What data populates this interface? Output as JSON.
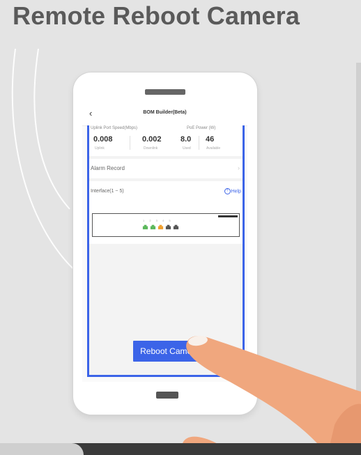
{
  "heading": "Remote Reboot Camera",
  "app": {
    "back_icon": "chevron-left-icon",
    "title": "BOM Builder(Beta)"
  },
  "stats": {
    "uplink_header": "Uplink Port Speed(Mbps)",
    "poe_header": "PoE Power (W)",
    "items": [
      {
        "value": "0.008",
        "label": "Uplink"
      },
      {
        "value": "0.002",
        "label": "Downlink"
      },
      {
        "value": "8.0",
        "label": "Used"
      },
      {
        "value": "46",
        "label": "Available"
      }
    ]
  },
  "alarm": {
    "label": "Alarm Record",
    "chevron_icon": "chevron-right-icon"
  },
  "interface": {
    "label": "Interface(1 ~ 5)",
    "help_label": "Help",
    "help_icon": "question-circle-icon",
    "port_numbers": "1 2 3 4 5",
    "ports": [
      {
        "status": "active",
        "color": "#5cb85c"
      },
      {
        "status": "active",
        "color": "#5cb85c"
      },
      {
        "status": "poe",
        "color": "#f0a030"
      },
      {
        "status": "inactive",
        "color": "#555555"
      },
      {
        "status": "inactive",
        "color": "#555555"
      }
    ]
  },
  "reboot_button": {
    "label": "Reboot Camera"
  },
  "colors": {
    "accent": "#3c64e8",
    "heading": "#5a5a5a",
    "hand_skin": "#f0a77e"
  }
}
